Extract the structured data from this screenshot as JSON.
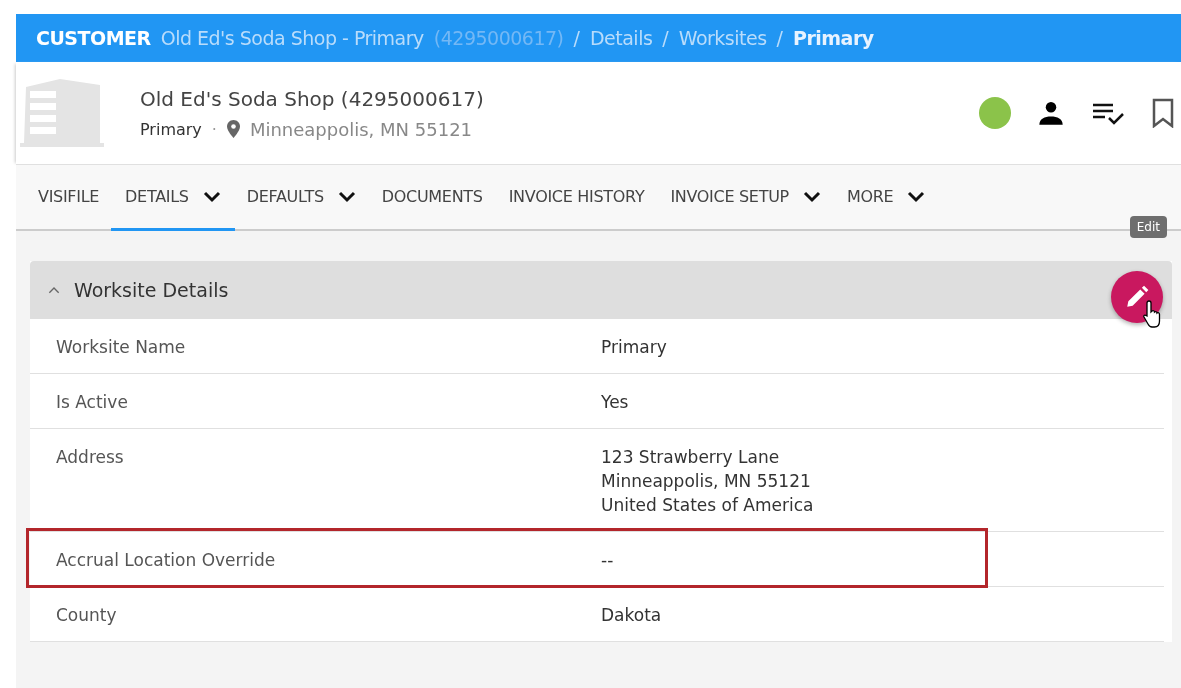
{
  "breadcrumb": {
    "section": "CUSTOMER",
    "separator": "/",
    "items": [
      {
        "label": "Old Ed's Soda Shop - Primary",
        "id_text": "(4295000617)",
        "current": false
      },
      {
        "label": "Details",
        "current": false
      },
      {
        "label": "Worksites",
        "current": false
      },
      {
        "label": "Primary",
        "current": true
      }
    ]
  },
  "header": {
    "title": "Old Ed's Soda Shop (4295000617)",
    "subtitle": "Primary",
    "separator": "·",
    "location": "Minneappolis, MN 55121",
    "status_dot": {
      "color": "#8bc34a"
    }
  },
  "tabs": [
    {
      "label": "VISIFILE",
      "selected": false,
      "dropdown": false
    },
    {
      "label": "DETAILS",
      "selected": true,
      "dropdown": true
    },
    {
      "label": "DEFAULTS",
      "selected": false,
      "dropdown": true
    },
    {
      "label": "DOCUMENTS",
      "selected": false,
      "dropdown": false
    },
    {
      "label": "INVOICE HISTORY",
      "selected": false,
      "dropdown": false
    },
    {
      "label": "INVOICE SETUP",
      "selected": false,
      "dropdown": true
    },
    {
      "label": "MORE",
      "selected": false,
      "dropdown": true
    }
  ],
  "tooltip": "Edit",
  "panel": {
    "title": "Worksite Details",
    "expanded": true,
    "rows": [
      {
        "label": "Worksite Name",
        "value": [
          "Primary"
        ],
        "highlighted": false
      },
      {
        "label": "Is Active",
        "value": [
          "Yes"
        ],
        "highlighted": false
      },
      {
        "label": "Address",
        "value": [
          "123 Strawberry Lane",
          "Minneappolis, MN 55121",
          "United States of America"
        ],
        "highlighted": false
      },
      {
        "label": "Accrual Location Override",
        "value": [
          "--"
        ],
        "highlighted": true
      },
      {
        "label": "County",
        "value": [
          "Dakota"
        ],
        "highlighted": false
      }
    ]
  }
}
